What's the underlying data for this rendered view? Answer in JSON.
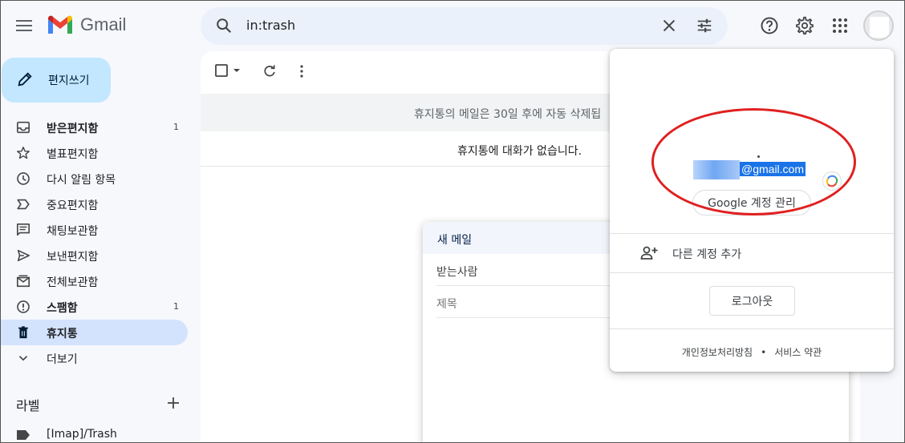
{
  "app": {
    "logo_text": "Gmail",
    "brand_colors": {
      "red": "#ea4335",
      "blue": "#4285f4",
      "green": "#34a853",
      "yellow": "#fbbc04"
    }
  },
  "search": {
    "value": "in:trash"
  },
  "compose_button": {
    "label": "편지쓰기"
  },
  "nav": [
    {
      "label": "받은편지함",
      "count": "1",
      "icon": "inbox-icon",
      "bold": true
    },
    {
      "label": "별표편지함",
      "count": "",
      "icon": "star-icon"
    },
    {
      "label": "다시 알림 항목",
      "count": "",
      "icon": "clock-icon"
    },
    {
      "label": "중요편지함",
      "count": "",
      "icon": "label-important-icon"
    },
    {
      "label": "채팅보관함",
      "count": "",
      "icon": "chat-icon"
    },
    {
      "label": "보낸편지함",
      "count": "",
      "icon": "send-icon"
    },
    {
      "label": "전체보관함",
      "count": "",
      "icon": "all-mail-icon"
    },
    {
      "label": "스팸함",
      "count": "1",
      "icon": "spam-icon",
      "bold": true
    },
    {
      "label": "휴지통",
      "count": "",
      "icon": "trash-icon",
      "bold": true,
      "active": true
    },
    {
      "label": "더보기",
      "count": "",
      "icon": "chevron-down-icon"
    }
  ],
  "labels": {
    "heading": "라벨",
    "items": [
      {
        "label": "[Imap]/Trash"
      }
    ]
  },
  "main": {
    "banner": "휴지통의 메일은 30일 후에 자동 삭제됩",
    "empty_message": "휴지통에 대화가 없습니다."
  },
  "compose_window": {
    "title": "새 메일",
    "to_label": "받는사람",
    "subject_placeholder": "제목"
  },
  "account_popup": {
    "email_suffix": "@gmail.com",
    "manage_button": "Google 계정 관리",
    "add_account": "다른 계정 추가",
    "logout": "로그아웃",
    "footer": {
      "privacy": "개인정보처리방침",
      "separator": "•",
      "terms": "서비스 약관"
    }
  }
}
